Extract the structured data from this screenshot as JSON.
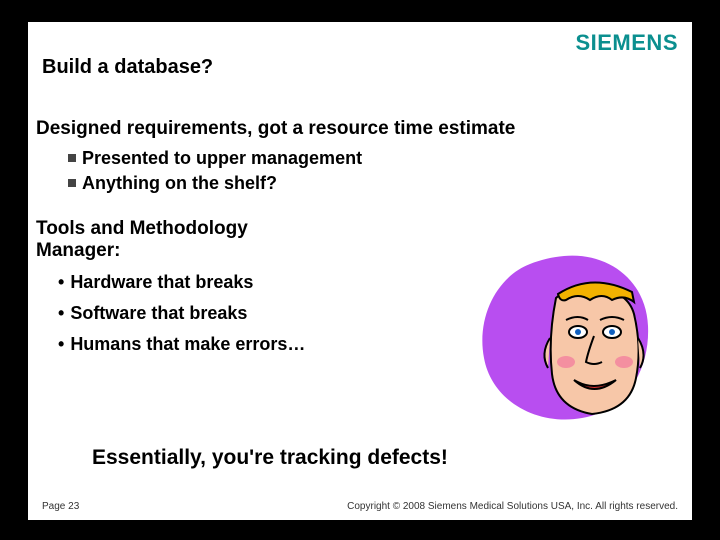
{
  "brand": "SIEMENS",
  "title": "Build a database?",
  "heading1": "Designed requirements, got a resource time estimate",
  "sub1": "Presented to upper management",
  "sub2": "Anything on the shelf?",
  "heading2": "Tools and Methodology Manager:",
  "bullet1": "Hardware that breaks",
  "bullet2": "Software that breaks",
  "bullet3": "Humans that make errors…",
  "punchline": "Essentially, you're tracking defects!",
  "footer_left": "Page 23",
  "footer_right": "Copyright © 2008 Siemens Medical Solutions USA, Inc. All rights reserved."
}
